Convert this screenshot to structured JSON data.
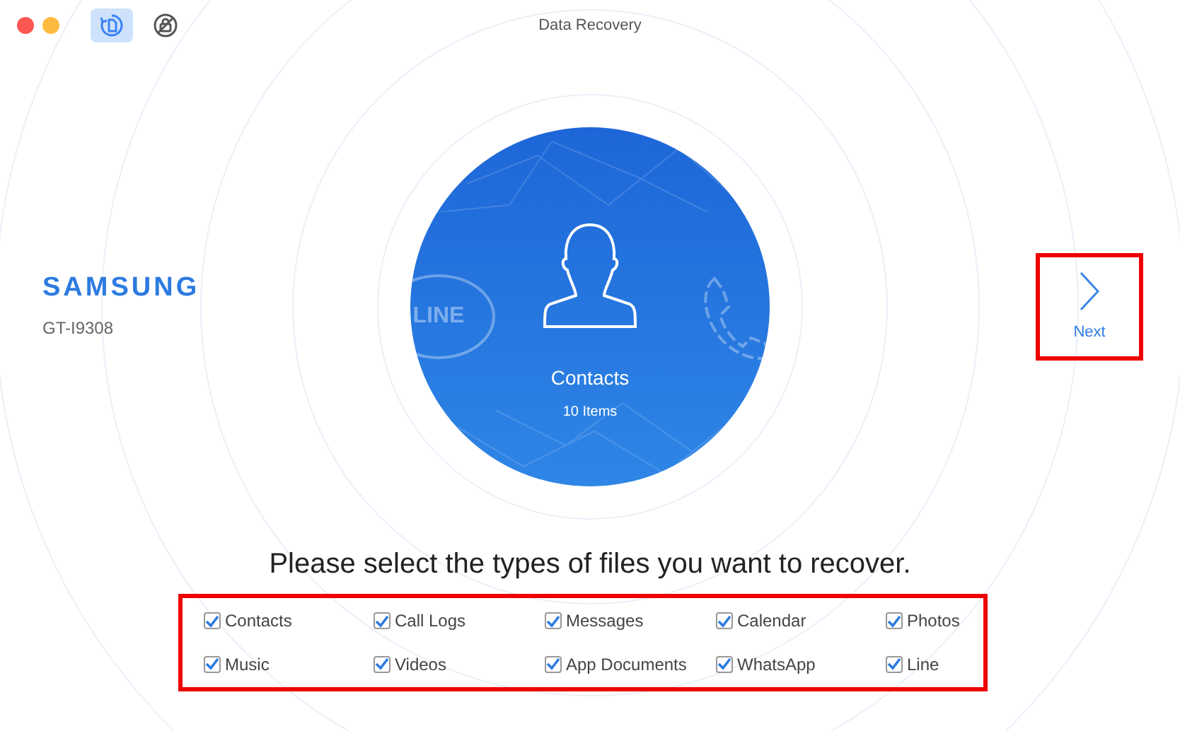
{
  "window": {
    "title": "Data Recovery"
  },
  "toolbar": [
    {
      "kind": "recover",
      "selected": true
    },
    {
      "kind": "lock",
      "selected": false
    }
  ],
  "device": {
    "brand": "SAMSUNG",
    "model": "GT-I9308"
  },
  "category": {
    "title": "Contacts",
    "count": "10 Items",
    "side_badge": "LINE"
  },
  "next_button": {
    "label": "Next"
  },
  "instruction": "Please select the types of files you want to recover.",
  "file_types": [
    {
      "label": "Contacts",
      "checked": true
    },
    {
      "label": "Call Logs",
      "checked": true
    },
    {
      "label": "Messages",
      "checked": true
    },
    {
      "label": "Calendar",
      "checked": true
    },
    {
      "label": "Photos",
      "checked": true
    },
    {
      "label": "Music",
      "checked": true
    },
    {
      "label": "Videos",
      "checked": true
    },
    {
      "label": "App Documents",
      "checked": true
    },
    {
      "label": "WhatsApp",
      "checked": true
    },
    {
      "label": "Line",
      "checked": true
    }
  ]
}
